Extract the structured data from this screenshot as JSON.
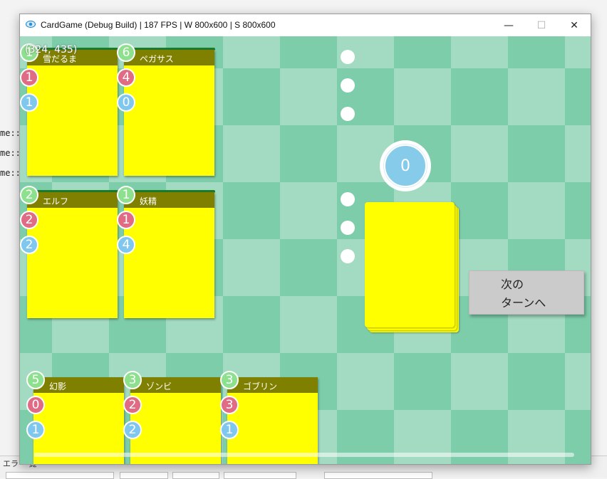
{
  "host": {
    "fragments": [
      "me::",
      "me::",
      "me::"
    ],
    "error_label": "エラー 覧"
  },
  "window": {
    "title": "CardGame (Debug Build) | 187 FPS | W 800x600 | S 800x600",
    "minimize_glyph": "—",
    "maximize_glyph": "☐",
    "close_glyph": "✕"
  },
  "game": {
    "coords": "(324, 435)",
    "turn": "0",
    "next_turn_button": {
      "line1": "次の",
      "line2": "ターンへ"
    },
    "field_cards": [
      {
        "name": "雪だるま",
        "cost": "1",
        "attack": "1",
        "hp": "1"
      },
      {
        "name": "ペガサス",
        "cost": "6",
        "attack": "4",
        "hp": "0"
      },
      {
        "name": "エルフ",
        "cost": "2",
        "attack": "2",
        "hp": "2"
      },
      {
        "name": "妖精",
        "cost": "1",
        "attack": "1",
        "hp": "4"
      }
    ],
    "hand_cards": [
      {
        "name": "幻影",
        "cost": "5",
        "attack": "0",
        "hp": "1"
      },
      {
        "name": "ゾンビ",
        "cost": "3",
        "attack": "2",
        "hp": "2"
      },
      {
        "name": "ゴブリン",
        "cost": "3",
        "attack": "3",
        "hp": "1"
      }
    ],
    "colors": {
      "card": "#ffff00",
      "namebar": "#808000",
      "cost": "#8de08d",
      "attack": "#e06b85",
      "hp": "#7fc7ee"
    }
  }
}
